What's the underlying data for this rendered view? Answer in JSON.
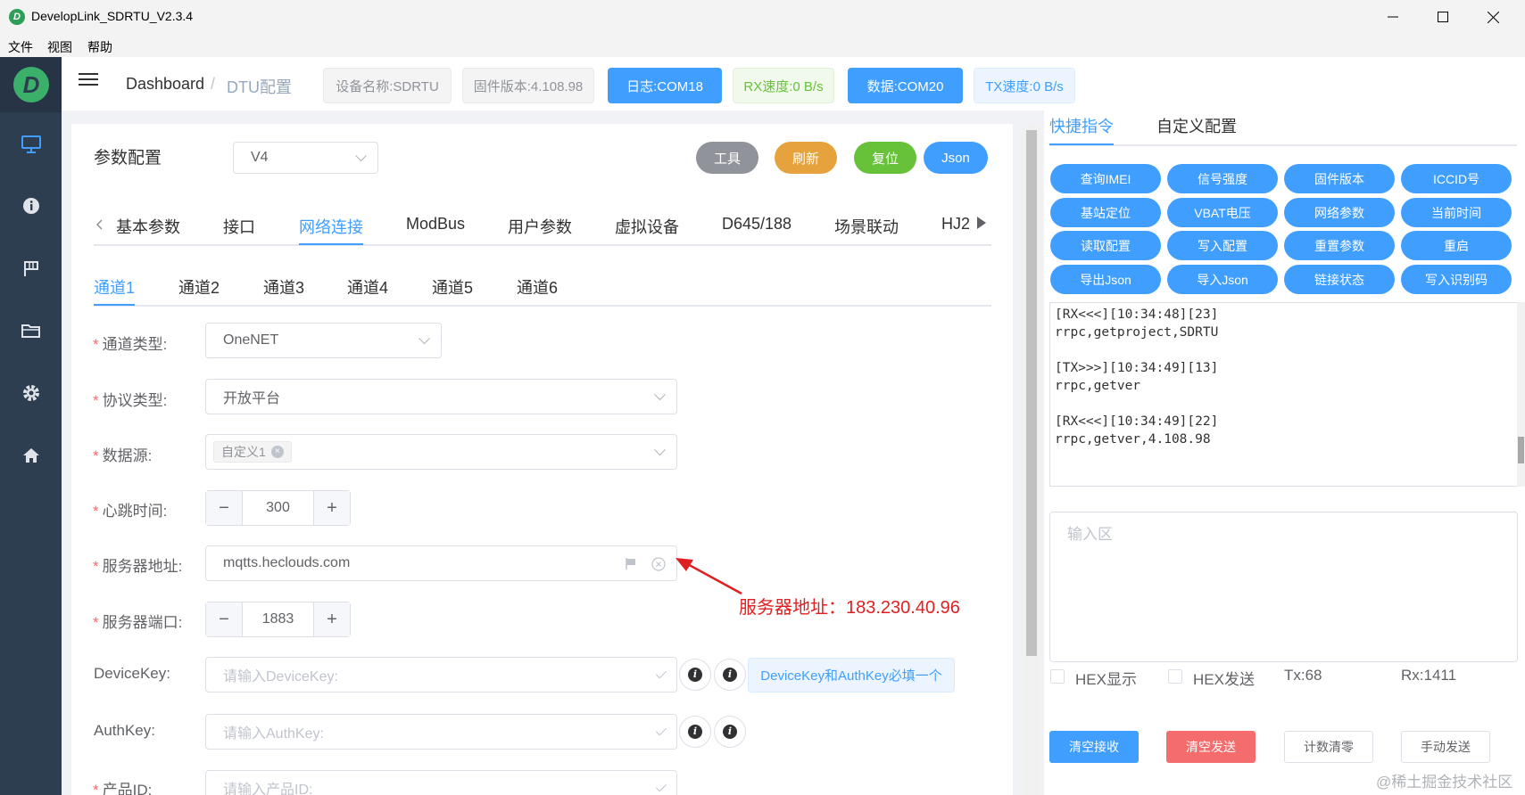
{
  "window": {
    "title": "DevelopLink_SDRTU_V2.3.4",
    "logo_letter": "D"
  },
  "menu": [
    "文件",
    "视图",
    "帮助"
  ],
  "sidebar": {
    "logo_letter": "D",
    "icons": [
      "monitor-icon",
      "info-icon",
      "flag-icon",
      "folder-icon",
      "gear-icon",
      "home-icon"
    ]
  },
  "breadcrumb": {
    "home": "Dashboard",
    "sep": "/",
    "current": "DTU配置"
  },
  "status_tags": {
    "device_name": "设备名称:SDRTU",
    "firmware": "固件版本:4.108.98",
    "log_port": "日志:COM18",
    "rx_speed": "RX速度:0 B/s",
    "data_port": "数据:COM20",
    "tx_speed": "TX速度:0 B/s"
  },
  "config": {
    "title": "参数配置",
    "version": "V4",
    "buttons": {
      "tools": "工具",
      "refresh": "刷新",
      "reset": "复位",
      "json": "Json"
    }
  },
  "main_tabs": [
    "基本参数",
    "接口",
    "网络连接",
    "ModBus",
    "用户参数",
    "虚拟设备",
    "D645/188",
    "场景联动",
    "HJ2"
  ],
  "active_main_tab": "网络连接",
  "channel_tabs": [
    "通道1",
    "通道2",
    "通道3",
    "通道4",
    "通道5",
    "通道6"
  ],
  "active_channel_tab": "通道1",
  "form": {
    "channel_type": {
      "label": "通道类型:",
      "value": "OneNET"
    },
    "protocol_type": {
      "label": "协议类型:",
      "value": "开放平台"
    },
    "data_source": {
      "label": "数据源:",
      "tag": "自定义1"
    },
    "heartbeat": {
      "label": "心跳时间:",
      "value": "300",
      "minus": "−",
      "plus": "+"
    },
    "server_address": {
      "label": "服务器地址:",
      "value": "mqtts.heclouds.com"
    },
    "server_port": {
      "label": "服务器端口:",
      "value": "1883",
      "minus": "−",
      "plus": "+"
    },
    "device_key": {
      "label": "DeviceKey:",
      "placeholder": "请输入DeviceKey:",
      "hint": "DeviceKey和AuthKey必填一个"
    },
    "auth_key": {
      "label": "AuthKey:",
      "placeholder": "请输入AuthKey:"
    },
    "product_id": {
      "label": "产品ID:",
      "placeholder": "请输入产品ID:"
    }
  },
  "annotation": {
    "text": "服务器地址：183.230.40.96",
    "color": "#e02020"
  },
  "right_panel": {
    "tabs": [
      "快捷指令",
      "自定义配置"
    ],
    "active_tab": "快捷指令",
    "quick_buttons": [
      "查询IMEI",
      "信号强度",
      "固件版本",
      "ICCID号",
      "基站定位",
      "VBAT电压",
      "网络参数",
      "当前时间",
      "读取配置",
      "写入配置",
      "重置参数",
      "重启",
      "导出Json",
      "导入Json",
      "链接状态",
      "写入识别码"
    ],
    "log_lines": [
      "[RX<<<][10:34:48][23]",
      "rrpc,getproject,SDRTU",
      "",
      "[TX>>>][10:34:49][13]",
      "rrpc,getver",
      "",
      "[RX<<<][10:34:49][22]",
      "rrpc,getver,4.108.98"
    ],
    "input_placeholder": "输入区",
    "hex_display": "HEX显示",
    "hex_send": "HEX发送",
    "tx_count": "Tx:68",
    "rx_count": "Rx:1411",
    "actions": {
      "clear_rx": "清空接收",
      "clear_tx": "清空发送",
      "reset_count": "计数清零",
      "manual_send": "手动发送"
    }
  },
  "watermark": "@稀土掘金技术社区",
  "colors": {
    "primary": "#409eff",
    "success": "#67c23a",
    "warning": "#e6a23c",
    "danger": "#f56c6c",
    "info": "#909399",
    "sidebar": "#2c3e50"
  }
}
